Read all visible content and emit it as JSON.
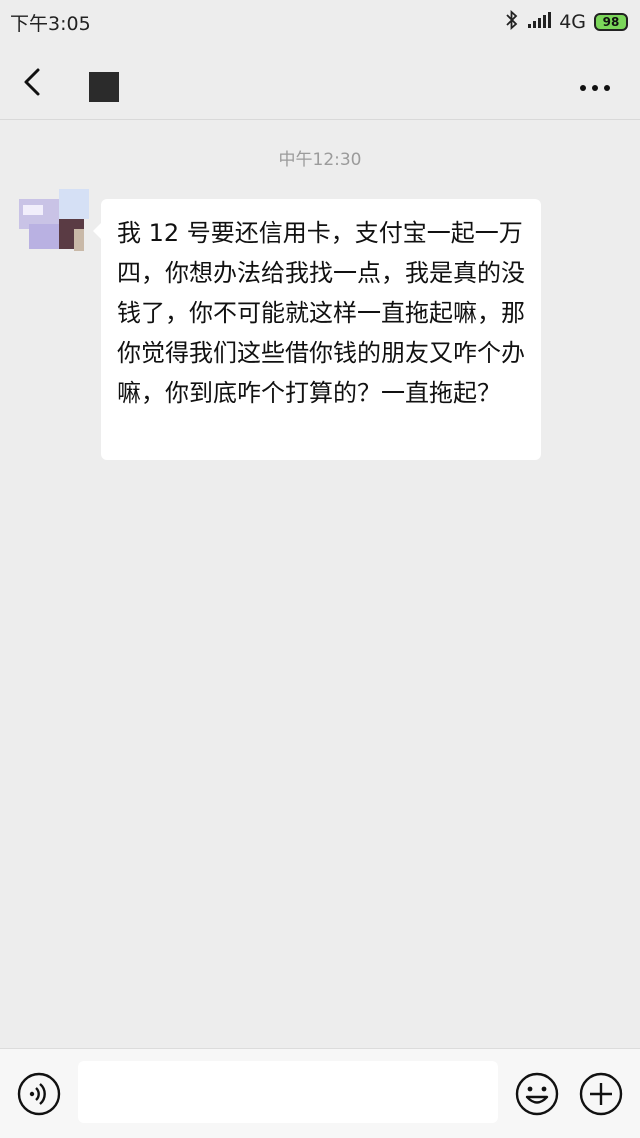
{
  "status_bar": {
    "time": "下午3:05",
    "network": "4G",
    "battery": "98",
    "icons": [
      "bluetooth-icon",
      "signal-icon",
      "battery-icon"
    ]
  },
  "nav": {
    "icons": [
      "back-arrow-icon",
      "more-dots-icon"
    ]
  },
  "chat": {
    "timestamp": "中午12:30",
    "messages": [
      {
        "sender": "contact",
        "text": "我 12 号要还信用卡，支付宝一起一万四，你想办法给我找一点，我是真的没钱了，你不可能就这样一直拖起嘛，那你觉得我们这些借你钱的朋友又咋个办嘛，你到底咋个打算的？一直拖起？"
      }
    ]
  },
  "input_bar": {
    "placeholder": "",
    "value": "",
    "icons": [
      "voice-icon",
      "emoji-icon",
      "plus-icon"
    ]
  },
  "colors": {
    "background": "#ededed",
    "bubble": "#ffffff",
    "battery": "#7bd65a",
    "timestamp": "#9b9b9b"
  }
}
